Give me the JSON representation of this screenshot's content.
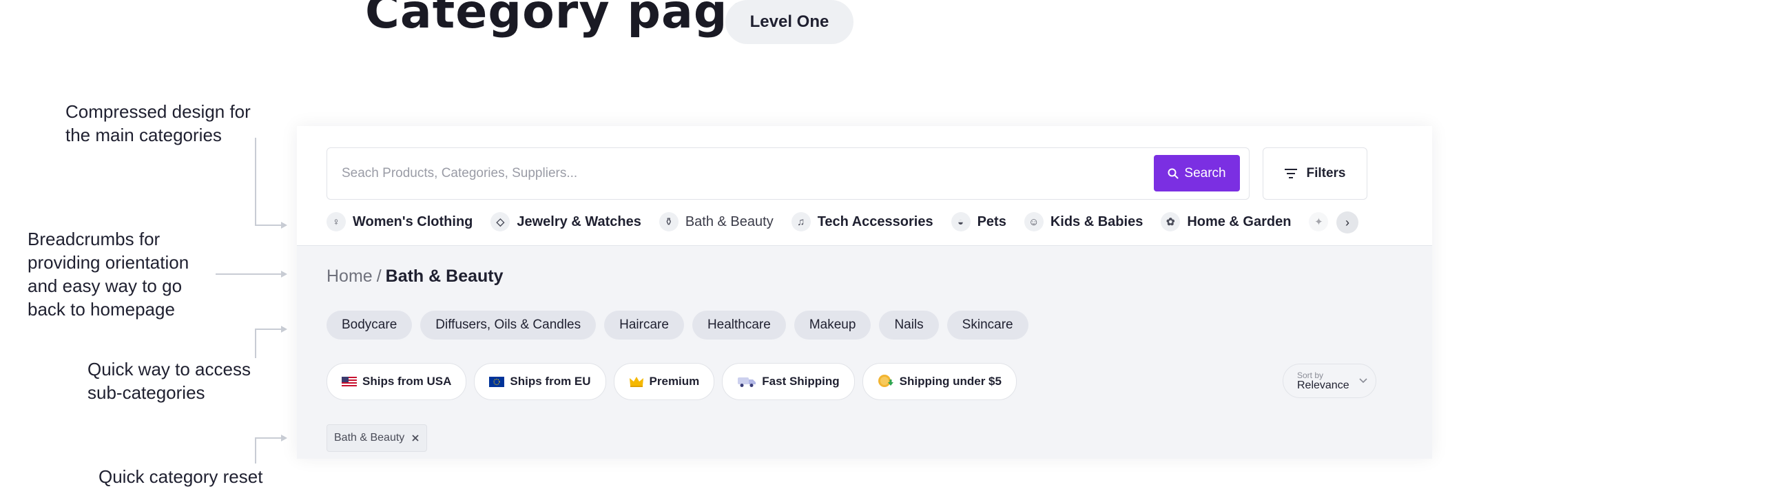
{
  "header": {
    "title": "Category page",
    "level_badge": "Level One"
  },
  "annotations": {
    "compressed": "Compressed design for\nthe main categories",
    "breadcrumbs": "Breadcrumbs for\nproviding orientation\nand easy way to go\nback to homepage",
    "subcats": "Quick way to access\nsub-categories",
    "reset": "Quick category reset"
  },
  "search": {
    "placeholder": "Seach Products, Categories, Suppliers...",
    "value": "",
    "button_label": "Search"
  },
  "filters": {
    "label": "Filters"
  },
  "categories": [
    {
      "label": "Women's Clothing",
      "icon": "dress-icon"
    },
    {
      "label": "Jewelry & Watches",
      "icon": "necklace-icon"
    },
    {
      "label": "Bath & Beauty",
      "icon": "bottle-icon"
    },
    {
      "label": "Tech Accessories",
      "icon": "headphones-icon"
    },
    {
      "label": "Pets",
      "icon": "pet-bowl-icon"
    },
    {
      "label": "Kids & Babies",
      "icon": "bib-icon"
    },
    {
      "label": "Home & Garden",
      "icon": "plant-icon"
    }
  ],
  "breadcrumb": {
    "home": "Home",
    "separator": "/",
    "current": "Bath & Beauty"
  },
  "subcategories": [
    "Bodycare",
    "Diffusers, Oils & Candles",
    "Haircare",
    "Healthcare",
    "Makeup",
    "Nails",
    "Skincare"
  ],
  "quick_filters": [
    {
      "label": "Ships from USA",
      "icon": "usa-flag-icon"
    },
    {
      "label": "Ships from EU",
      "icon": "eu-flag-icon"
    },
    {
      "label": "Premium",
      "icon": "crown-icon"
    },
    {
      "label": "Fast Shipping",
      "icon": "truck-icon"
    },
    {
      "label": "Shipping under $5",
      "icon": "coin-icon"
    }
  ],
  "sort": {
    "label": "Sort by",
    "value": "Relevance"
  },
  "active_filter": {
    "label": "Bath & Beauty"
  },
  "colors": {
    "accent": "#7b2fe2",
    "panel": "#f3f4f7",
    "pill": "#e3e5ec"
  }
}
